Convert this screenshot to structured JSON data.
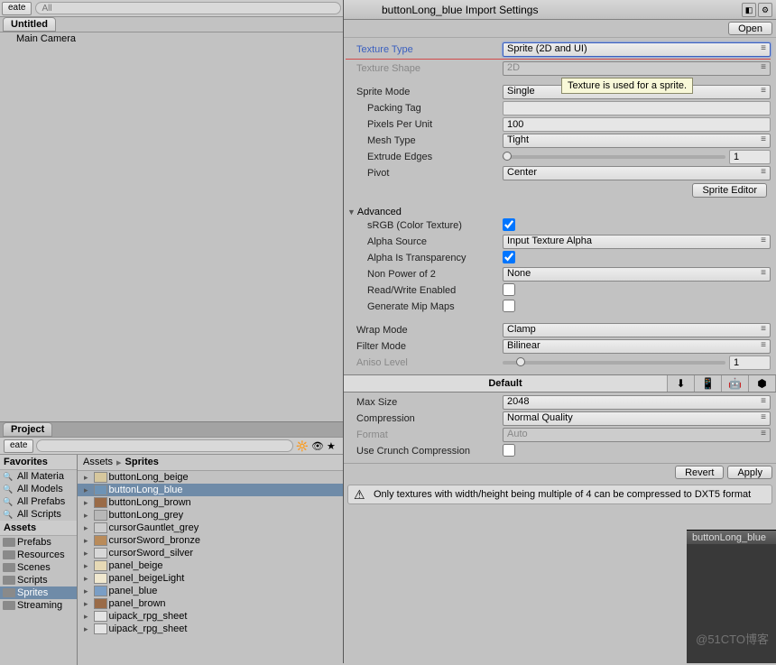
{
  "hierarchy": {
    "create": "eate",
    "search_ph": "All",
    "scene": "Untitled",
    "items": [
      "Main Camera"
    ]
  },
  "project": {
    "tab": "Project",
    "create": "eate",
    "favorites_label": "Favorites",
    "favorites": [
      "All Materia",
      "All Models",
      "All Prefabs",
      "All Scripts"
    ],
    "assets_label": "Assets",
    "folders": [
      "Prefabs",
      "Resources",
      "Scenes",
      "Scripts",
      "Sprites",
      "Streaming"
    ],
    "selected_folder": "Sprites",
    "crumb_root": "Assets",
    "crumb_leaf": "Sprites",
    "items": [
      {
        "n": "buttonLong_beige",
        "c": "#d6c79d"
      },
      {
        "n": "buttonLong_blue",
        "c": "#6e93b5",
        "sel": true
      },
      {
        "n": "buttonLong_brown",
        "c": "#9a6b47"
      },
      {
        "n": "buttonLong_grey",
        "c": "#b8b8b8"
      },
      {
        "n": "cursorGauntlet_grey",
        "c": "#cccccc"
      },
      {
        "n": "cursorSword_bronze",
        "c": "#b98b5a"
      },
      {
        "n": "cursorSword_silver",
        "c": "#d8d8d8"
      },
      {
        "n": "panel_beige",
        "c": "#e6d9b5"
      },
      {
        "n": "panel_beigeLight",
        "c": "#f0e8cf"
      },
      {
        "n": "panel_blue",
        "c": "#7a9ec5"
      },
      {
        "n": "panel_brown",
        "c": "#9a6b47"
      },
      {
        "n": "uipack_rpg_sheet",
        "c": "#e4e4e4"
      },
      {
        "n": "uipack_rpg_sheet",
        "c": "#e4e4e4"
      }
    ]
  },
  "inspector": {
    "title": "buttonLong_blue Import Settings",
    "open": "Open",
    "texture_type_lbl": "Texture Type",
    "texture_type": "Sprite (2D and UI)",
    "texture_shape_lbl": "Texture Shape",
    "texture_shape": "2D",
    "tooltip": "Texture is used for a sprite.",
    "sprite_mode_lbl": "Sprite Mode",
    "sprite_mode": "Single",
    "packing_tag_lbl": "Packing Tag",
    "packing_tag": "",
    "ppu_lbl": "Pixels Per Unit",
    "ppu": "100",
    "mesh_type_lbl": "Mesh Type",
    "mesh_type": "Tight",
    "extrude_lbl": "Extrude Edges",
    "extrude": "1",
    "pivot_lbl": "Pivot",
    "pivot": "Center",
    "sprite_editor": "Sprite Editor",
    "advanced": "Advanced",
    "srgb_lbl": "sRGB (Color Texture)",
    "alpha_src_lbl": "Alpha Source",
    "alpha_src": "Input Texture Alpha",
    "alpha_trans_lbl": "Alpha Is Transparency",
    "npot_lbl": "Non Power of 2",
    "npot": "None",
    "rw_lbl": "Read/Write Enabled",
    "mip_lbl": "Generate Mip Maps",
    "wrap_lbl": "Wrap Mode",
    "wrap": "Clamp",
    "filter_lbl": "Filter Mode",
    "filter": "Bilinear",
    "aniso_lbl": "Aniso Level",
    "aniso": "1",
    "platform_default": "Default",
    "max_size_lbl": "Max Size",
    "max_size": "2048",
    "compression_lbl": "Compression",
    "compression": "Normal Quality",
    "format_lbl": "Format",
    "format": "Auto",
    "crunch_lbl": "Use Crunch Compression",
    "revert": "Revert",
    "apply": "Apply",
    "warning": "Only textures with width/height being multiple of 4 can be compressed to DXT5 format"
  },
  "preview": {
    "title": "buttonLong_blue"
  },
  "watermark": "@51CTO博客"
}
